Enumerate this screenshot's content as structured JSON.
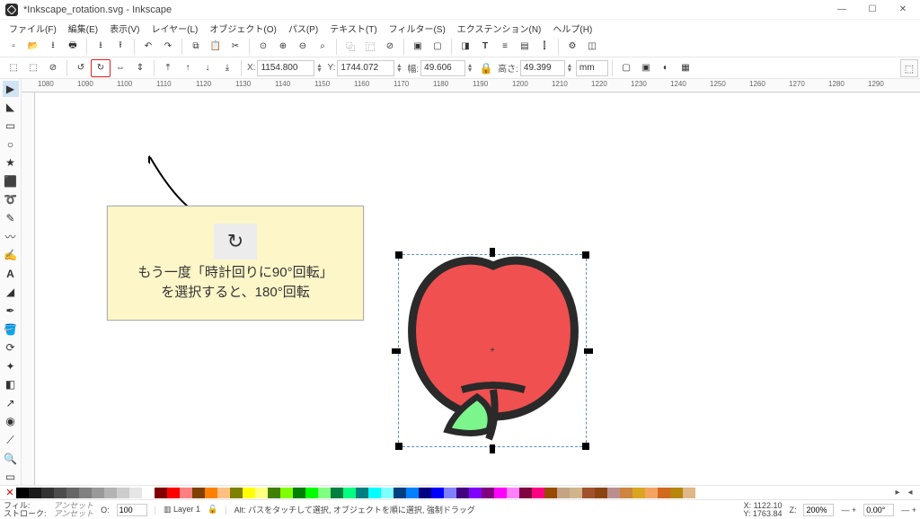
{
  "window": {
    "title": "*Inkscape_rotation.svg - Inkscape"
  },
  "menus": [
    "ファイル(F)",
    "編集(E)",
    "表示(V)",
    "レイヤー(L)",
    "オブジェクト(O)",
    "パス(P)",
    "テキスト(T)",
    "フィルター(S)",
    "エクステンション(N)",
    "ヘルプ(H)"
  ],
  "toolbar2": {
    "x_label": "X:",
    "x": "1154.800",
    "y_label": "Y:",
    "y": "1744.072",
    "w_label": "幅:",
    "w": "49.606",
    "h_label": "高さ:",
    "h": "49.399",
    "unit": "mm"
  },
  "ruler_marks": [
    "1080",
    "1090",
    "1100",
    "1110",
    "1120",
    "1130",
    "1140",
    "1150",
    "1160",
    "1170",
    "1180",
    "1190",
    "1200",
    "1210",
    "1220",
    "1230",
    "1240",
    "1250",
    "1260",
    "1270",
    "1280",
    "1290"
  ],
  "annotation": {
    "line1": "もう一度「時計回りに90°回転」",
    "line2": "を選択すると、180°回転"
  },
  "status": {
    "fill_label": "フィル:",
    "stroke_label": "ストローク:",
    "unset": "アンセット",
    "opacity_label": "O:",
    "opacity": "100",
    "layer": "Layer 1",
    "hint": "Alt: パスをタッチして選択, オブジェクトを順に選択, 強制ドラッグ",
    "x_label": "X:",
    "y_label": "Y:",
    "x": "1122.10",
    "y": "1763.84",
    "z_label": "Z:",
    "zoom": "200%",
    "rot": "0.00°"
  }
}
